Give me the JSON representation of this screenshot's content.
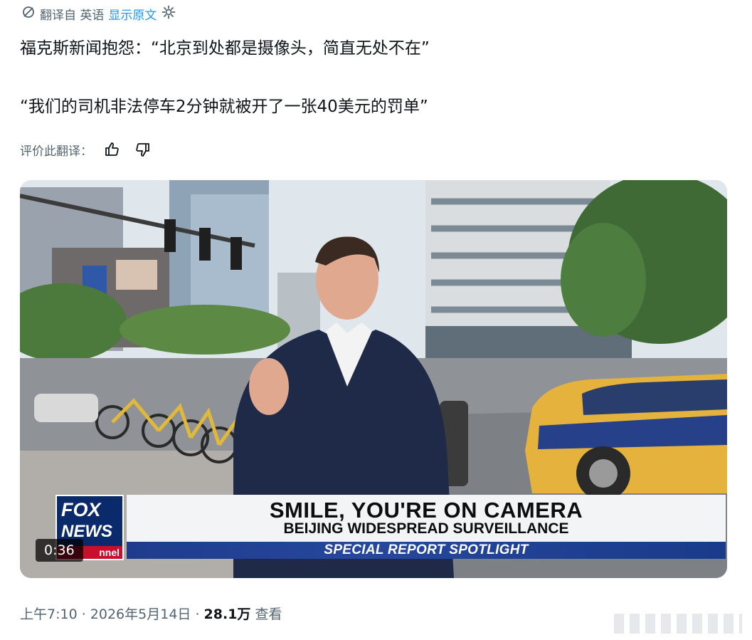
{
  "translation_bar": {
    "icon": "translate-slash-icon",
    "translated_from": "翻译自 英语",
    "show_original": "显示原文",
    "settings_icon": "gear-icon"
  },
  "post": {
    "line1": "福克斯新闻抱怨：“北京到处都是摄像头，简直无处不在”",
    "line2": "“我们的司机非法停车2分钟就被开了一张40美元的罚单”",
    "rate_label": "评价此翻译：",
    "thumbs_up_icon": "thumbs-up-icon",
    "thumbs_down_icon": "thumbs-down-icon"
  },
  "video": {
    "headline": "SMILE, YOU'RE ON CAMERA",
    "subline": "BEIJING WIDESPREAD SURVEILLANCE",
    "segment": "SPECIAL REPORT SPOTLIGHT",
    "logo_fox": "FOX",
    "logo_news": "NEWS",
    "logo_channel": "nnel",
    "duration": "0:36",
    "colors": {
      "banner_blue": "#1f3c8c",
      "logo_blue": "#0a2a6b",
      "logo_red": "#c8102e"
    }
  },
  "meta": {
    "time": "上午7:10",
    "sep1": " · ",
    "date": "2026年5月14日",
    "sep2": " · ",
    "views": "28.1万",
    "views_label": " 查看"
  }
}
